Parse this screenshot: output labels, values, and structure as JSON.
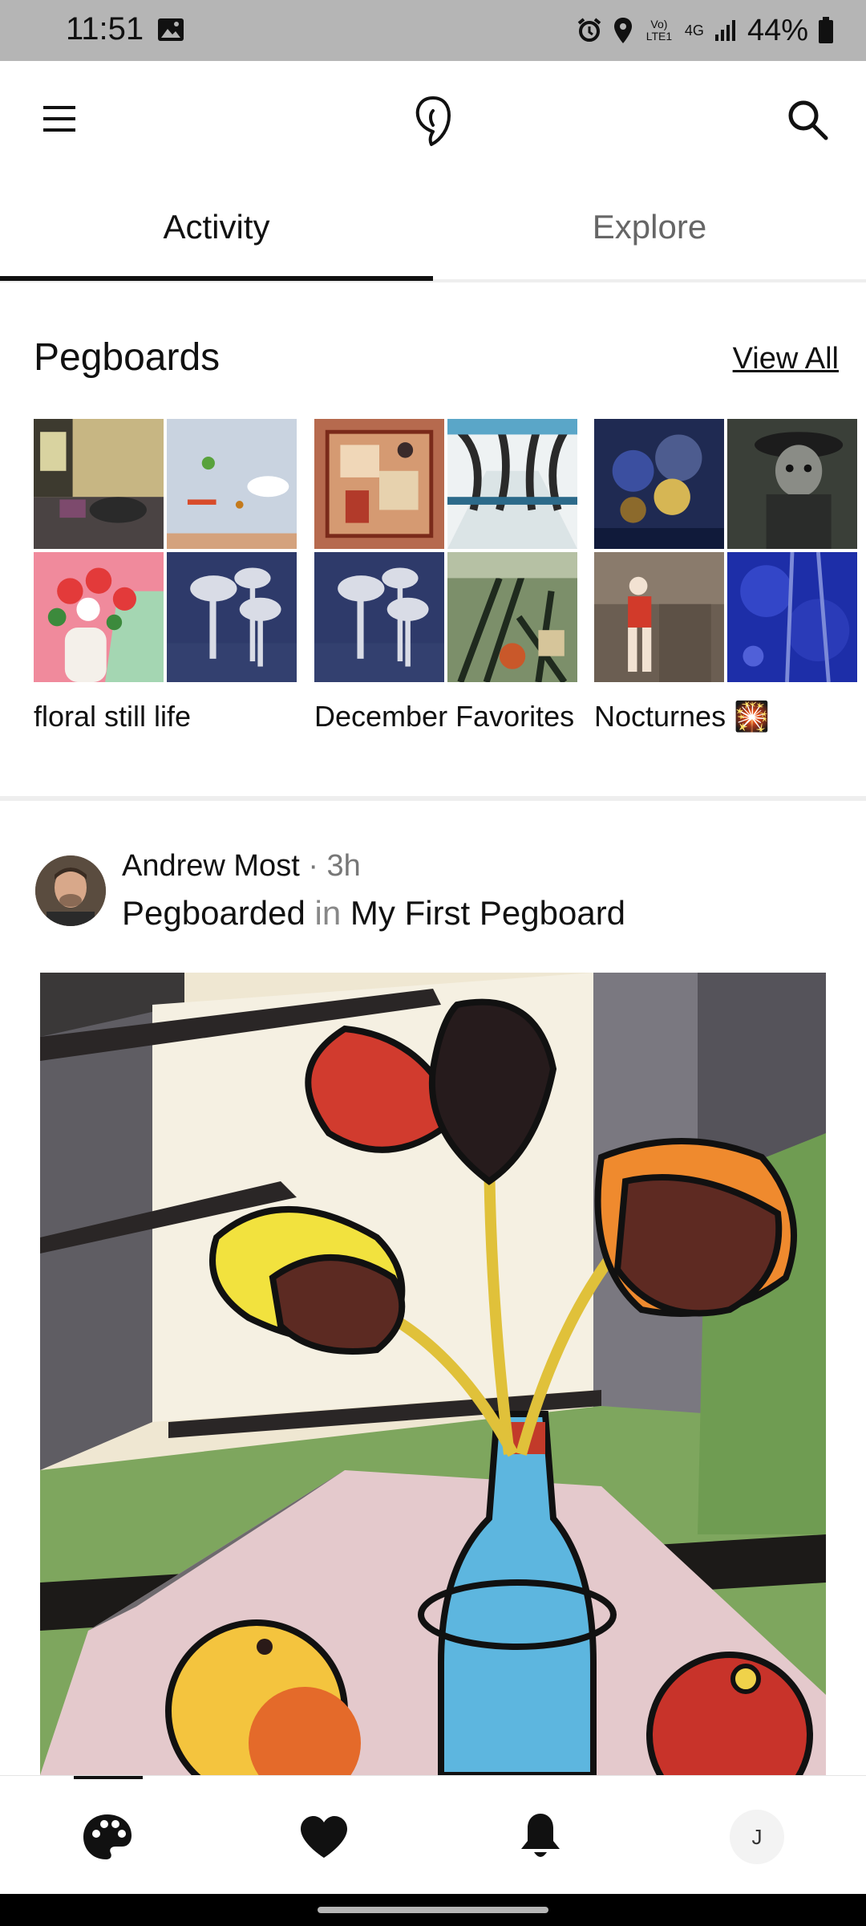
{
  "status_bar": {
    "time": "11:51",
    "battery": "44%",
    "network": "4G",
    "volte": "Vo) LTE1"
  },
  "app_bar": {
    "menu_icon": "hamburger-menu-icon",
    "logo_icon": "pegboard-logo-icon",
    "search_icon": "search-icon"
  },
  "tabs": [
    {
      "label": "Activity",
      "active": true
    },
    {
      "label": "Explore",
      "active": false
    }
  ],
  "pegboards": {
    "title": "Pegboards",
    "view_all": "View All",
    "boards": [
      {
        "name": "floral still life"
      },
      {
        "name": "December Favorites"
      },
      {
        "name": "Nocturnes 🎇"
      }
    ]
  },
  "post": {
    "user": "Andrew Most",
    "time_ago": "3h",
    "action": "Pegboarded",
    "preposition": "in",
    "board": "My First Pegboard"
  },
  "bottom_nav": {
    "items": [
      "palette-icon",
      "heart-icon",
      "bell-icon",
      "profile-avatar"
    ],
    "profile_initial": "J"
  },
  "colors": {
    "accent": "#111111",
    "muted_text": "#888888",
    "status_bar": "#b5b5b5"
  }
}
